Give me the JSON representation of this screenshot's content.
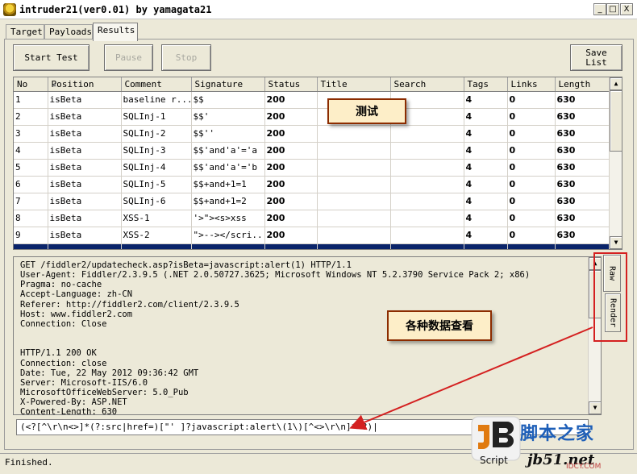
{
  "window": {
    "title": "intruder21(ver0.01) by yamagata21",
    "minimize": "_",
    "maximize": "□",
    "close": "X"
  },
  "tabs": [
    {
      "label": "Target"
    },
    {
      "label": "Payloads"
    },
    {
      "label": "Results"
    }
  ],
  "toolbar": {
    "start_label": "Start Test",
    "pause_label": "Pause",
    "stop_label": "Stop",
    "save_line1": "Save",
    "save_line2": "List"
  },
  "grid": {
    "columns": [
      "No",
      "Position",
      "Comment",
      "Signature",
      "Status",
      "Title",
      "Search",
      "Tags",
      "Links",
      "Length"
    ],
    "rows": [
      {
        "no": "1",
        "position": "isBeta",
        "comment": "baseline r...",
        "signature": "$$",
        "status": "200",
        "title": "",
        "search": "",
        "tags": "4",
        "links": "0",
        "length": "630"
      },
      {
        "no": "2",
        "position": "isBeta",
        "comment": "SQLInj-1",
        "signature": "$$'",
        "status": "200",
        "title": "",
        "search": "",
        "tags": "4",
        "links": "0",
        "length": "630"
      },
      {
        "no": "3",
        "position": "isBeta",
        "comment": "SQLInj-2",
        "signature": "$$''",
        "status": "200",
        "title": "",
        "search": "",
        "tags": "4",
        "links": "0",
        "length": "630"
      },
      {
        "no": "4",
        "position": "isBeta",
        "comment": "SQLInj-3",
        "signature": "$$'and'a'='a",
        "status": "200",
        "title": "",
        "search": "",
        "tags": "4",
        "links": "0",
        "length": "630"
      },
      {
        "no": "5",
        "position": "isBeta",
        "comment": "SQLInj-4",
        "signature": "$$'and'a'='b",
        "status": "200",
        "title": "",
        "search": "",
        "tags": "4",
        "links": "0",
        "length": "630"
      },
      {
        "no": "6",
        "position": "isBeta",
        "comment": "SQLInj-5",
        "signature": "$$+and+1=1",
        "status": "200",
        "title": "",
        "search": "",
        "tags": "4",
        "links": "0",
        "length": "630"
      },
      {
        "no": "7",
        "position": "isBeta",
        "comment": "SQLInj-6",
        "signature": "$$+and+1=2",
        "status": "200",
        "title": "",
        "search": "",
        "tags": "4",
        "links": "0",
        "length": "630"
      },
      {
        "no": "8",
        "position": "isBeta",
        "comment": "XSS-1",
        "signature": "'>\"><s>xss",
        "status": "200",
        "title": "",
        "search": "",
        "tags": "4",
        "links": "0",
        "length": "630"
      },
      {
        "no": "9",
        "position": "isBeta",
        "comment": "XSS-2",
        "signature": "\">--></scri...",
        "status": "200",
        "title": "",
        "search": "",
        "tags": "4",
        "links": "0",
        "length": "630"
      }
    ]
  },
  "detail": {
    "text": "GET /fiddler2/updatecheck.asp?isBeta=javascript:alert(1) HTTP/1.1\nUser-Agent: Fiddler/2.3.9.5 (.NET 2.0.50727.3625; Microsoft Windows NT 5.2.3790 Service Pack 2; x86)\nPragma: no-cache\nAccept-Language: zh-CN\nReferer: http://fiddler2.com/client/2.3.9.5\nHost: www.fiddler2.com\nConnection: Close\n\n\nHTTP/1.1 200 OK\nConnection: close\nDate: Tue, 22 May 2012 09:36:42 GMT\nServer: Microsoft-IIS/6.0\nMicrosoftOfficeWebServer: 5.0_Pub\nX-Powered-By: ASP.NET\nContent-Length: 630",
    "raw_tab": "Raw",
    "render_tab": "Render"
  },
  "regex": {
    "value": "(<?[^\\r\\n<>]*(?:src|href=)[\"' ]?javascript:alert\\(1\\)[^<>\\r\\n]*>?)|"
  },
  "annotations": {
    "test_label": "测试",
    "views_label": "各种数据查看",
    "accent_color": "#d42020"
  },
  "status": {
    "text": "Finished."
  },
  "watermark": {
    "script_label": "Script",
    "site_cn": "脚本之家",
    "site_url": "jb51.net",
    "idcy": "IDCY.COM"
  }
}
